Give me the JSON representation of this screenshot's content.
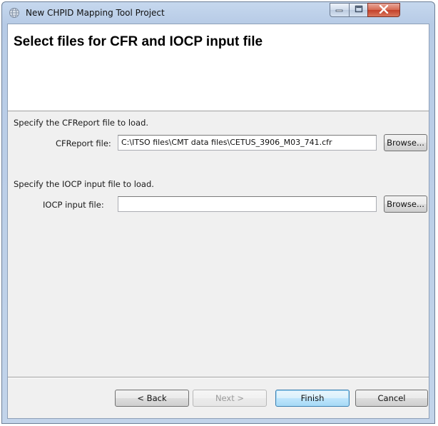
{
  "window": {
    "title": "New CHPID Mapping Tool Project",
    "controls": {
      "minimize": "minimize",
      "maximize": "maximize",
      "close": "close"
    }
  },
  "banner": {
    "title": "Select files for CFR and IOCP input file"
  },
  "cfreport": {
    "instruction": "Specify the CFReport file to load.",
    "label": "CFReport file:",
    "value": "C:\\ITSO files\\CMT data files\\CETUS_3906_M03_741.cfr",
    "browse_label": "Browse..."
  },
  "iocp": {
    "instruction": "Specify the IOCP input file to load.",
    "label": "IOCP input file:",
    "value": "",
    "browse_label": "Browse..."
  },
  "footer": {
    "back_label": "< Back",
    "next_label": "Next >",
    "finish_label": "Finish",
    "cancel_label": "Cancel"
  },
  "icons": {
    "app": "globe-icon",
    "minimize": "minimize-icon",
    "maximize": "maximize-icon",
    "close": "close-icon"
  },
  "colors": {
    "title_bar": "#c6d8ee",
    "close_button": "#c3402a",
    "dialog_body": "#f0f0f0",
    "banner": "#ffffff",
    "default_button_border": "#3c7fb1"
  }
}
